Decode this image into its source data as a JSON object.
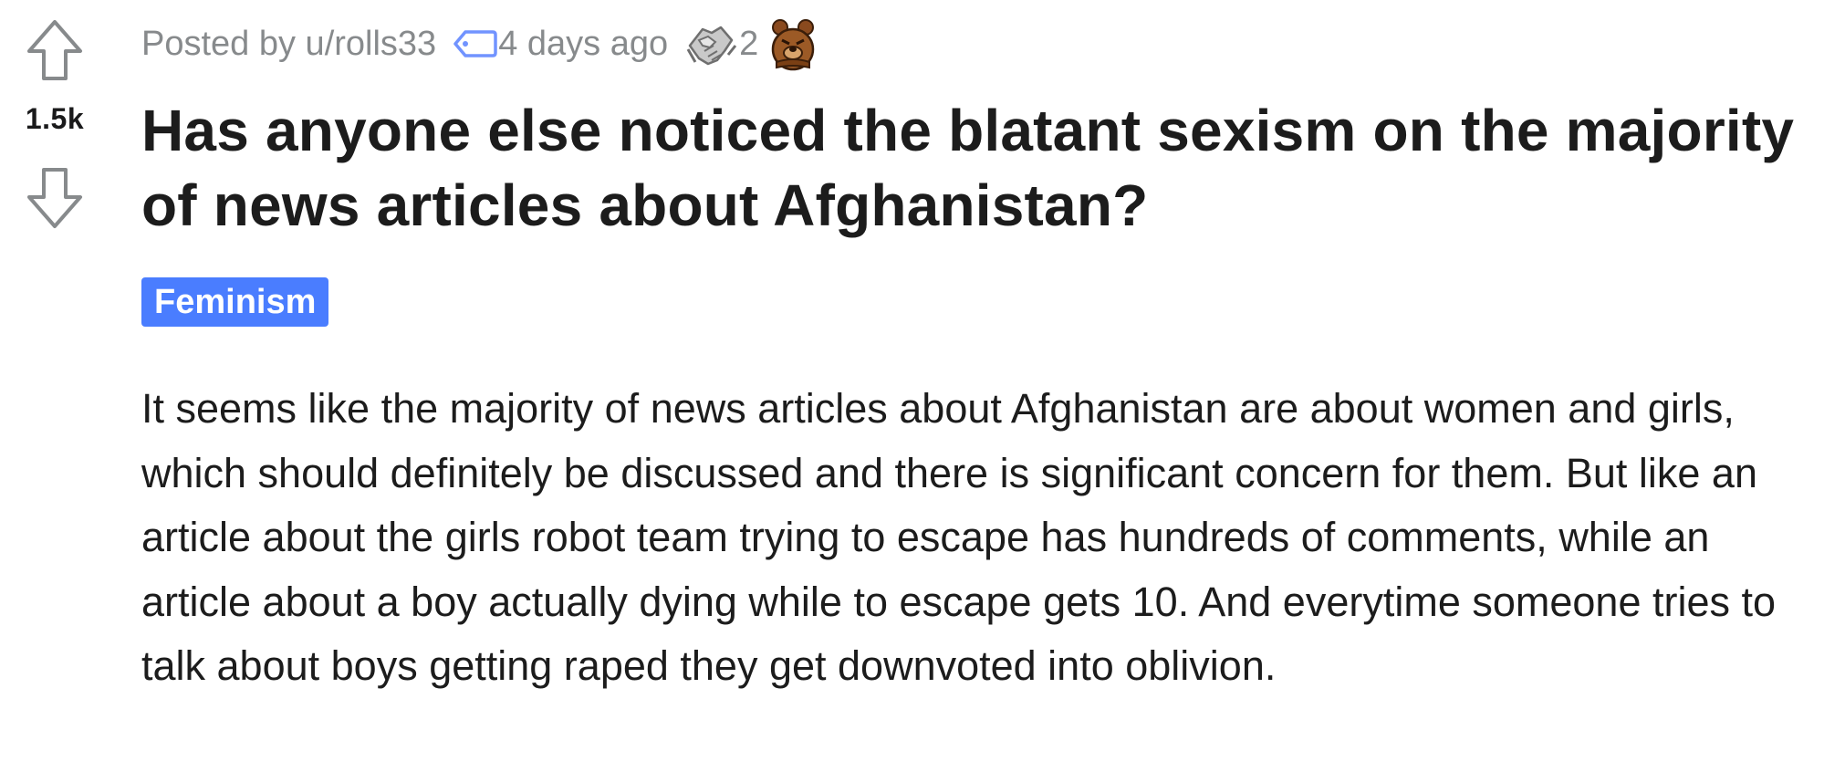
{
  "vote": {
    "score": "1.5k",
    "upvote_icon": "arrow-up-outline-icon",
    "downvote_icon": "arrow-down-outline-icon"
  },
  "meta": {
    "posted_by": "Posted by u/rolls33",
    "time": "4 days ago",
    "award_count": "2",
    "icons": [
      "tag-icon",
      "handshake-award-icon",
      "bear-award-icon"
    ]
  },
  "post": {
    "title": "Has anyone else noticed the blatant sexism on the majority of news articles about Afghanistan?",
    "flair": "Feminism",
    "body": "It seems like the majority of news articles about Afghanistan are about women and girls, which should definitely be discussed and there is significant concern for them. But like an article about the girls robot team trying to escape has hundreds of comments, while an article about a boy actually dying while to escape gets 10. And everytime someone tries to talk about boys getting raped they get downvoted into oblivion."
  },
  "colors": {
    "flair_bg": "#4a7dff",
    "meta_text": "#878a8c",
    "text": "#1c1c1c",
    "tag_icon": "#7193ff"
  }
}
